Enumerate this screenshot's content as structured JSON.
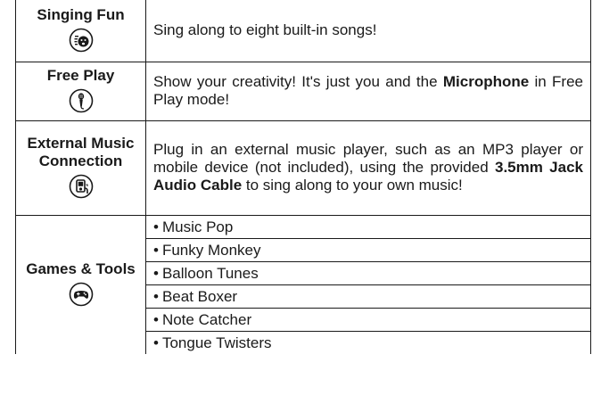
{
  "rows": [
    {
      "title": "Singing Fun",
      "icon": "singing-fun-icon",
      "description": "Sing along to eight built-in songs!"
    },
    {
      "title": "Free Play",
      "icon": "microphone-icon",
      "description_parts": [
        "Show your creativity! It's just you and the ",
        "Microphone",
        " in Free Play mode!"
      ]
    },
    {
      "title_lines": [
        "External Music",
        "Connection"
      ],
      "icon": "music-player-icon",
      "description_parts": [
        "Plug in an external music player, such as an MP3 player or mobile device (not included), using the provided ",
        "3.5mm Jack Audio Cable",
        " to sing along to your own music!"
      ]
    },
    {
      "title": "Games & Tools",
      "icon": "gamepad-icon",
      "bullet": "•",
      "items": [
        "Music Pop",
        "Funky Monkey",
        "Balloon Tunes",
        "Beat Boxer",
        "Note Catcher",
        "Tongue Twisters"
      ]
    }
  ]
}
